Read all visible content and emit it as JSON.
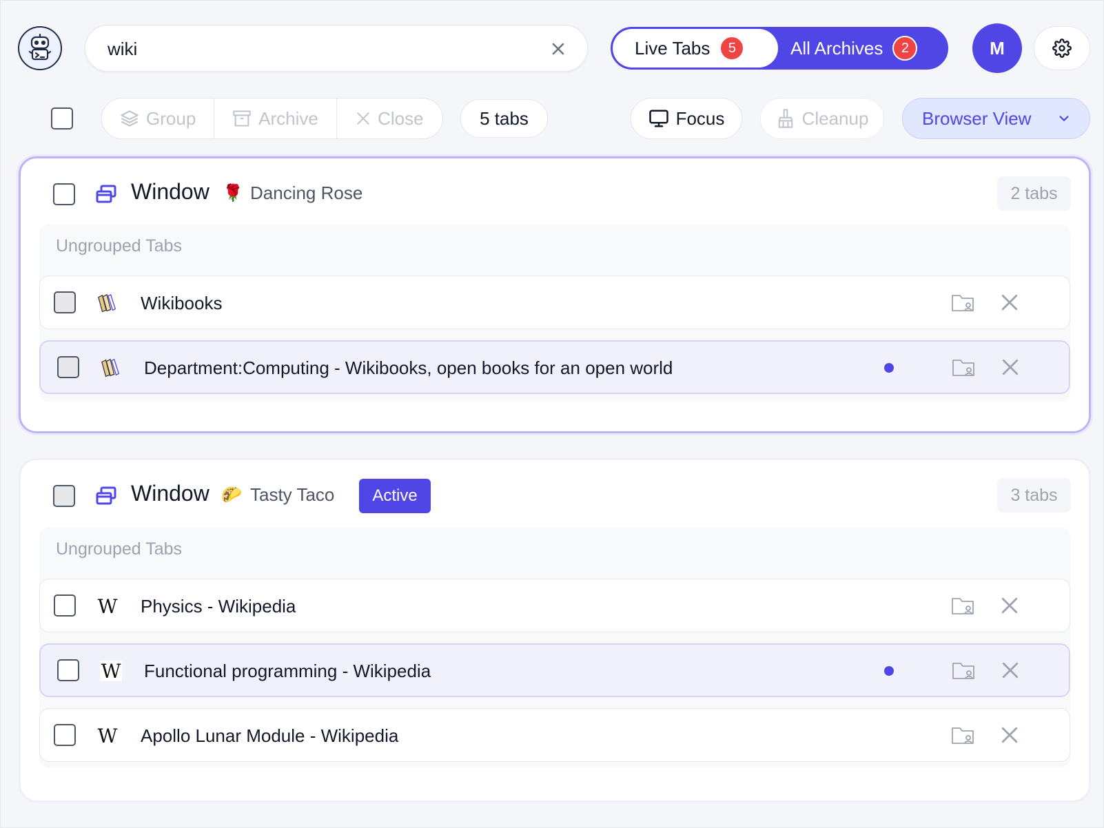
{
  "search": {
    "value": "wiki"
  },
  "segmented": {
    "live_tabs_label": "Live Tabs",
    "live_tabs_count": "5",
    "all_archives_label": "All Archives",
    "all_archives_count": "2"
  },
  "user": {
    "initial": "M"
  },
  "toolbar": {
    "group_label": "Group",
    "archive_label": "Archive",
    "close_label": "Close",
    "tab_count": "5 tabs",
    "focus_label": "Focus",
    "cleanup_label": "Cleanup",
    "view_label": "Browser View"
  },
  "windows": [
    {
      "title": "Window",
      "emoji": "🌹",
      "name": "Dancing Rose",
      "tab_count": "2 tabs",
      "group_label": "Ungrouped Tabs",
      "tabs": [
        {
          "title": "Wikibooks",
          "favicon": "wikibooks-icon"
        },
        {
          "title": "Department:Computing - Wikibooks, open books for an open world",
          "favicon": "wikibooks-icon"
        }
      ]
    },
    {
      "title": "Window",
      "emoji": "🌮",
      "name": "Tasty Taco",
      "active_label": "Active",
      "tab_count": "3 tabs",
      "group_label": "Ungrouped Tabs",
      "tabs": [
        {
          "title": "Physics - Wikipedia",
          "favicon": "W"
        },
        {
          "title": "Functional programming - Wikipedia",
          "favicon": "W"
        },
        {
          "title": "Apollo Lunar Module - Wikipedia",
          "favicon": "W"
        }
      ]
    }
  ],
  "colors": {
    "accent": "#4f46e5",
    "badge": "#ef4444",
    "highlight_row": "#f1f1fb"
  }
}
